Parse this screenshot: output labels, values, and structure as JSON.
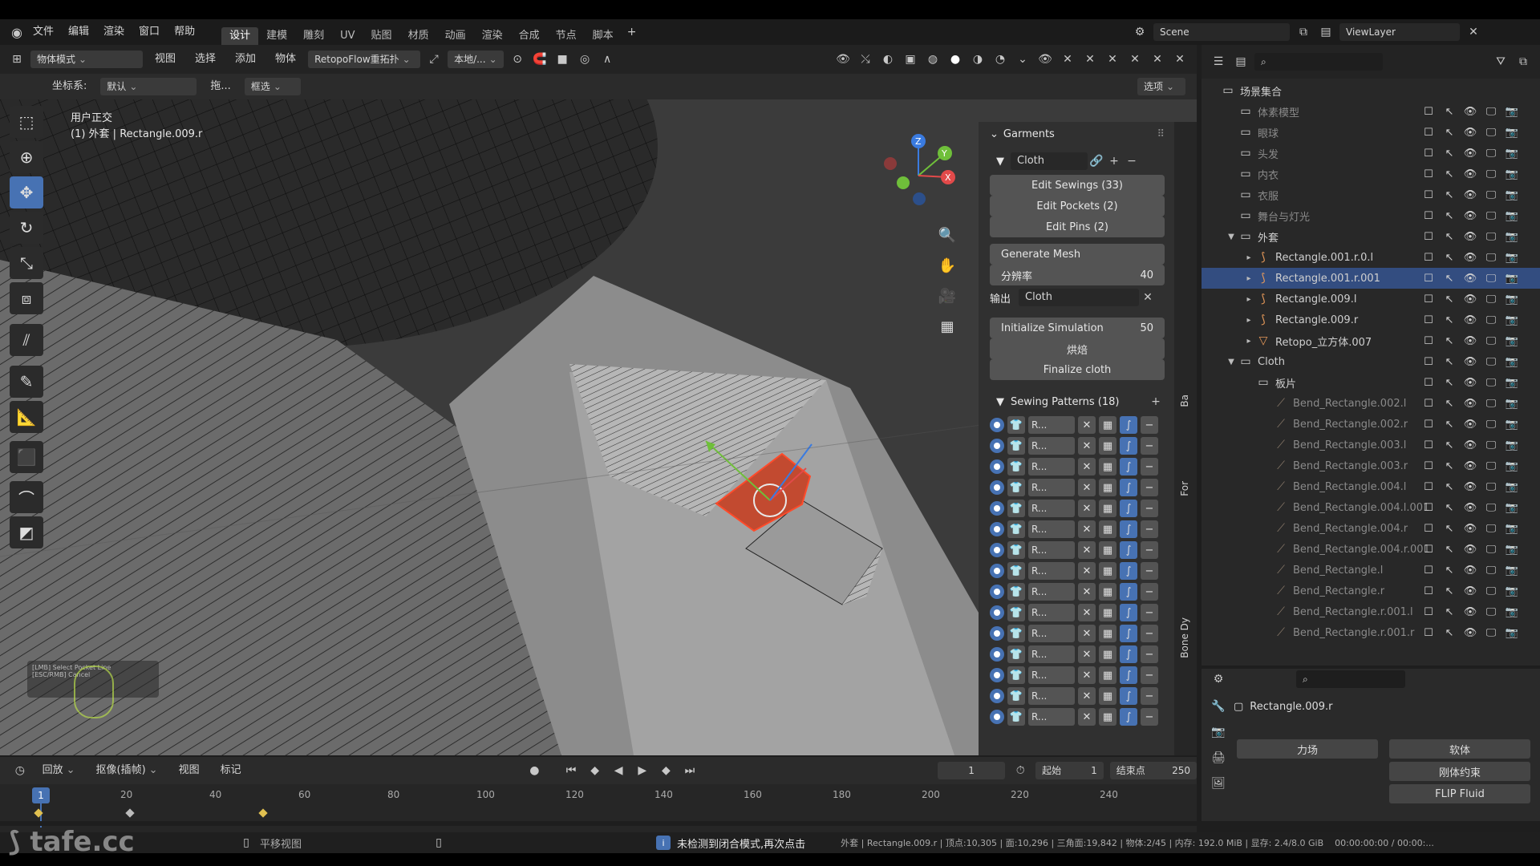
{
  "menu": {
    "file": "文件",
    "edit": "编辑",
    "render": "渲染",
    "window": "窗口",
    "help": "帮助"
  },
  "workspaces": [
    "设计",
    "建模",
    "雕刻",
    "UV",
    "贴图",
    "材质",
    "动画",
    "渲染",
    "合成",
    "节点",
    "脚本"
  ],
  "scene": {
    "name": "Scene",
    "view_layer": "ViewLayer"
  },
  "header": {
    "mode": "物体模式",
    "view": "视图",
    "select": "选择",
    "add": "添加",
    "object": "物体",
    "addon": "RetopoFlow重拓扑",
    "orient": "本地/...",
    "coord_label": "坐标系:",
    "coord_value": "默认",
    "drag": "拖...",
    "select_mode": "框选",
    "options": "选项"
  },
  "viewport": {
    "view_name": "用户正交",
    "object_info": "(1) 外套 | Rectangle.009.r",
    "hint1": "[LMB] Select Pocket Line",
    "hint2": "[ESC/RMB] Cancel"
  },
  "npanel": {
    "section": "Garments",
    "cloth": "Cloth",
    "edit_sewings": "Edit Sewings (33)",
    "edit_pockets": "Edit Pockets (2)",
    "edit_pins": "Edit Pins (2)",
    "generate_mesh": "Generate Mesh",
    "resolution_label": "分辨率",
    "resolution": "40",
    "output_label": "输出",
    "output_value": "Cloth",
    "init_sim": "Initialize Simulation",
    "init_sim_value": "50",
    "bake": "烘焙",
    "finalize": "Finalize cloth",
    "sewing_patterns": "Sewing Patterns (18)",
    "pattern_label": "R...",
    "tabs": [
      "Ba",
      "For",
      "Bone Dy"
    ]
  },
  "outliner": {
    "rows": [
      {
        "name": "场景集合",
        "type": "scene",
        "indent": 0
      },
      {
        "name": "体素模型",
        "type": "coll",
        "indent": 1,
        "dim": true
      },
      {
        "name": "眼球",
        "type": "coll",
        "indent": 1,
        "dim": true
      },
      {
        "name": "头发",
        "type": "coll",
        "indent": 1,
        "dim": true
      },
      {
        "name": "内衣",
        "type": "coll",
        "indent": 1,
        "dim": true
      },
      {
        "name": "衣服",
        "type": "coll",
        "indent": 1,
        "dim": true
      },
      {
        "name": "舞台与灯光",
        "type": "coll",
        "indent": 1,
        "dim": true
      },
      {
        "name": "外套",
        "type": "coll",
        "indent": 1,
        "expanded": true
      },
      {
        "name": "Rectangle.001.r.0.l",
        "type": "curve",
        "indent": 2
      },
      {
        "name": "Rectangle.001.r.001",
        "type": "curve",
        "indent": 2,
        "selected": true
      },
      {
        "name": "Rectangle.009.l",
        "type": "curve",
        "indent": 2
      },
      {
        "name": "Rectangle.009.r",
        "type": "curve",
        "indent": 2
      },
      {
        "name": "Retopo_立方体.007",
        "type": "mesh",
        "indent": 2
      },
      {
        "name": "Cloth",
        "type": "coll",
        "indent": 1,
        "expanded": true
      },
      {
        "name": "板片",
        "type": "coll",
        "indent": 2
      },
      {
        "name": "Bend_Rectangle.002.l",
        "type": "bone",
        "indent": 3,
        "dim": true
      },
      {
        "name": "Bend_Rectangle.002.r",
        "type": "bone",
        "indent": 3,
        "dim": true
      },
      {
        "name": "Bend_Rectangle.003.l",
        "type": "bone",
        "indent": 3,
        "dim": true
      },
      {
        "name": "Bend_Rectangle.003.r",
        "type": "bone",
        "indent": 3,
        "dim": true
      },
      {
        "name": "Bend_Rectangle.004.l",
        "type": "bone",
        "indent": 3,
        "dim": true
      },
      {
        "name": "Bend_Rectangle.004.l.001",
        "type": "bone",
        "indent": 3,
        "dim": true
      },
      {
        "name": "Bend_Rectangle.004.r",
        "type": "bone",
        "indent": 3,
        "dim": true
      },
      {
        "name": "Bend_Rectangle.004.r.001",
        "type": "bone",
        "indent": 3,
        "dim": true
      },
      {
        "name": "Bend_Rectangle.l",
        "type": "bone",
        "indent": 3,
        "dim": true
      },
      {
        "name": "Bend_Rectangle.r",
        "type": "bone",
        "indent": 3,
        "dim": true
      },
      {
        "name": "Bend_Rectangle.r.001.l",
        "type": "bone",
        "indent": 3,
        "dim": true
      },
      {
        "name": "Bend_Rectangle.r.001.r",
        "type": "bone",
        "indent": 3,
        "dim": true
      }
    ]
  },
  "properties": {
    "object": "Rectangle.009.r",
    "force_field": "力场",
    "soft_body": "软体",
    "rigid_constraint": "刚体约束",
    "fluid": "FLIP Fluid"
  },
  "timeline": {
    "playback": "回放",
    "keying": "抠像(插帧)",
    "view": "视图",
    "marker": "标记",
    "current_frame": "1",
    "start_label": "起始",
    "start": "1",
    "end_label": "结束点",
    "end": "250",
    "ticks": [
      "20",
      "40",
      "60",
      "80",
      "100",
      "120",
      "140",
      "160",
      "180",
      "200",
      "220",
      "240"
    ]
  },
  "status": {
    "pan": "平移视图",
    "message": "未检测到闭合模式,再次点击",
    "stats": "外套 | Rectangle.009.r | 顶点:10,305 | 面:10,296 | 三角面:19,842 | 物体:2/45 | 内存: 192.0 MiB | 显存: 2.4/8.0 GiB",
    "time": "00:00:00:00 / 00:00:..."
  },
  "watermark": "tafe.cc",
  "colors": {
    "accent": "#4772b3",
    "selection": "#e0452e",
    "bg": "#3e3e3e"
  }
}
